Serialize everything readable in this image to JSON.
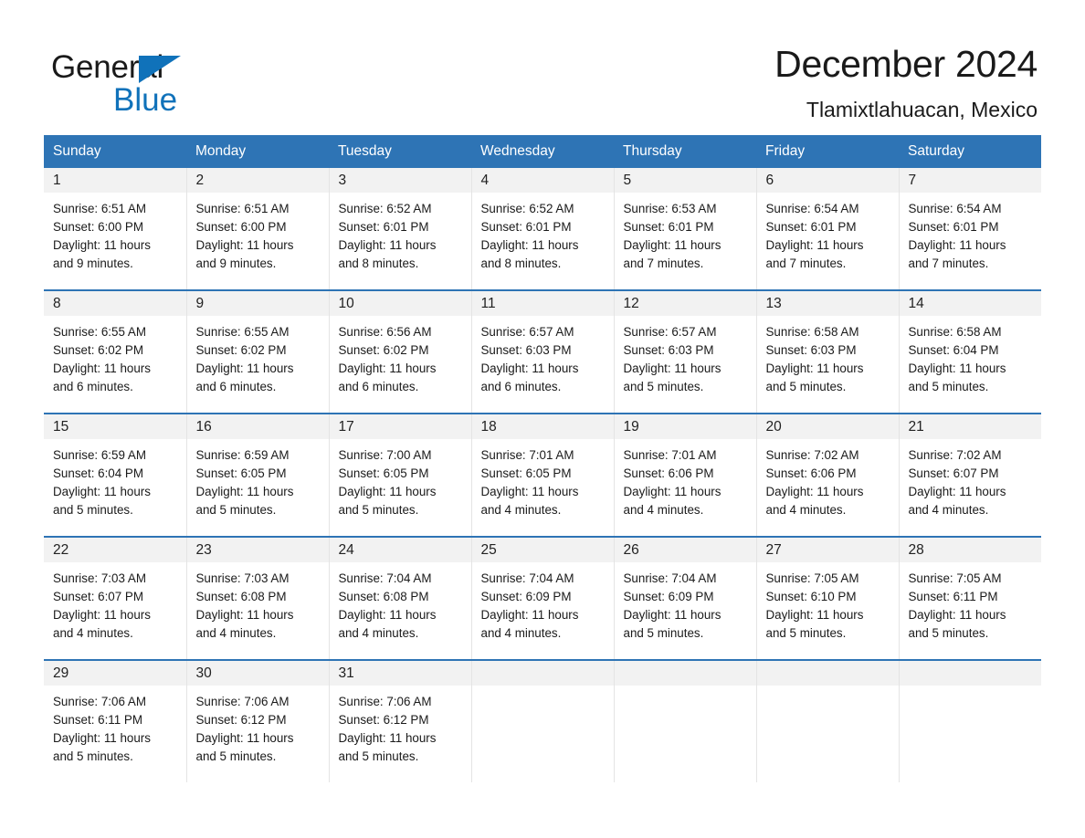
{
  "brand": {
    "name_part1": "General",
    "name_part2": "Blue",
    "accent_color": "#1072BA"
  },
  "header": {
    "title": "December 2024",
    "subtitle": "Tlamixtlahuacan, Mexico",
    "header_bar_color": "#2E74B5",
    "daynum_bg_color": "#F2F2F2"
  },
  "weekday_headers": [
    "Sunday",
    "Monday",
    "Tuesday",
    "Wednesday",
    "Thursday",
    "Friday",
    "Saturday"
  ],
  "weeks": [
    [
      {
        "day": "1",
        "sunrise": "Sunrise: 6:51 AM",
        "sunset": "Sunset: 6:00 PM",
        "daylight_line1": "Daylight: 11 hours",
        "daylight_line2": "and 9 minutes."
      },
      {
        "day": "2",
        "sunrise": "Sunrise: 6:51 AM",
        "sunset": "Sunset: 6:00 PM",
        "daylight_line1": "Daylight: 11 hours",
        "daylight_line2": "and 9 minutes."
      },
      {
        "day": "3",
        "sunrise": "Sunrise: 6:52 AM",
        "sunset": "Sunset: 6:01 PM",
        "daylight_line1": "Daylight: 11 hours",
        "daylight_line2": "and 8 minutes."
      },
      {
        "day": "4",
        "sunrise": "Sunrise: 6:52 AM",
        "sunset": "Sunset: 6:01 PM",
        "daylight_line1": "Daylight: 11 hours",
        "daylight_line2": "and 8 minutes."
      },
      {
        "day": "5",
        "sunrise": "Sunrise: 6:53 AM",
        "sunset": "Sunset: 6:01 PM",
        "daylight_line1": "Daylight: 11 hours",
        "daylight_line2": "and 7 minutes."
      },
      {
        "day": "6",
        "sunrise": "Sunrise: 6:54 AM",
        "sunset": "Sunset: 6:01 PM",
        "daylight_line1": "Daylight: 11 hours",
        "daylight_line2": "and 7 minutes."
      },
      {
        "day": "7",
        "sunrise": "Sunrise: 6:54 AM",
        "sunset": "Sunset: 6:01 PM",
        "daylight_line1": "Daylight: 11 hours",
        "daylight_line2": "and 7 minutes."
      }
    ],
    [
      {
        "day": "8",
        "sunrise": "Sunrise: 6:55 AM",
        "sunset": "Sunset: 6:02 PM",
        "daylight_line1": "Daylight: 11 hours",
        "daylight_line2": "and 6 minutes."
      },
      {
        "day": "9",
        "sunrise": "Sunrise: 6:55 AM",
        "sunset": "Sunset: 6:02 PM",
        "daylight_line1": "Daylight: 11 hours",
        "daylight_line2": "and 6 minutes."
      },
      {
        "day": "10",
        "sunrise": "Sunrise: 6:56 AM",
        "sunset": "Sunset: 6:02 PM",
        "daylight_line1": "Daylight: 11 hours",
        "daylight_line2": "and 6 minutes."
      },
      {
        "day": "11",
        "sunrise": "Sunrise: 6:57 AM",
        "sunset": "Sunset: 6:03 PM",
        "daylight_line1": "Daylight: 11 hours",
        "daylight_line2": "and 6 minutes."
      },
      {
        "day": "12",
        "sunrise": "Sunrise: 6:57 AM",
        "sunset": "Sunset: 6:03 PM",
        "daylight_line1": "Daylight: 11 hours",
        "daylight_line2": "and 5 minutes."
      },
      {
        "day": "13",
        "sunrise": "Sunrise: 6:58 AM",
        "sunset": "Sunset: 6:03 PM",
        "daylight_line1": "Daylight: 11 hours",
        "daylight_line2": "and 5 minutes."
      },
      {
        "day": "14",
        "sunrise": "Sunrise: 6:58 AM",
        "sunset": "Sunset: 6:04 PM",
        "daylight_line1": "Daylight: 11 hours",
        "daylight_line2": "and 5 minutes."
      }
    ],
    [
      {
        "day": "15",
        "sunrise": "Sunrise: 6:59 AM",
        "sunset": "Sunset: 6:04 PM",
        "daylight_line1": "Daylight: 11 hours",
        "daylight_line2": "and 5 minutes."
      },
      {
        "day": "16",
        "sunrise": "Sunrise: 6:59 AM",
        "sunset": "Sunset: 6:05 PM",
        "daylight_line1": "Daylight: 11 hours",
        "daylight_line2": "and 5 minutes."
      },
      {
        "day": "17",
        "sunrise": "Sunrise: 7:00 AM",
        "sunset": "Sunset: 6:05 PM",
        "daylight_line1": "Daylight: 11 hours",
        "daylight_line2": "and 5 minutes."
      },
      {
        "day": "18",
        "sunrise": "Sunrise: 7:01 AM",
        "sunset": "Sunset: 6:05 PM",
        "daylight_line1": "Daylight: 11 hours",
        "daylight_line2": "and 4 minutes."
      },
      {
        "day": "19",
        "sunrise": "Sunrise: 7:01 AM",
        "sunset": "Sunset: 6:06 PM",
        "daylight_line1": "Daylight: 11 hours",
        "daylight_line2": "and 4 minutes."
      },
      {
        "day": "20",
        "sunrise": "Sunrise: 7:02 AM",
        "sunset": "Sunset: 6:06 PM",
        "daylight_line1": "Daylight: 11 hours",
        "daylight_line2": "and 4 minutes."
      },
      {
        "day": "21",
        "sunrise": "Sunrise: 7:02 AM",
        "sunset": "Sunset: 6:07 PM",
        "daylight_line1": "Daylight: 11 hours",
        "daylight_line2": "and 4 minutes."
      }
    ],
    [
      {
        "day": "22",
        "sunrise": "Sunrise: 7:03 AM",
        "sunset": "Sunset: 6:07 PM",
        "daylight_line1": "Daylight: 11 hours",
        "daylight_line2": "and 4 minutes."
      },
      {
        "day": "23",
        "sunrise": "Sunrise: 7:03 AM",
        "sunset": "Sunset: 6:08 PM",
        "daylight_line1": "Daylight: 11 hours",
        "daylight_line2": "and 4 minutes."
      },
      {
        "day": "24",
        "sunrise": "Sunrise: 7:04 AM",
        "sunset": "Sunset: 6:08 PM",
        "daylight_line1": "Daylight: 11 hours",
        "daylight_line2": "and 4 minutes."
      },
      {
        "day": "25",
        "sunrise": "Sunrise: 7:04 AM",
        "sunset": "Sunset: 6:09 PM",
        "daylight_line1": "Daylight: 11 hours",
        "daylight_line2": "and 4 minutes."
      },
      {
        "day": "26",
        "sunrise": "Sunrise: 7:04 AM",
        "sunset": "Sunset: 6:09 PM",
        "daylight_line1": "Daylight: 11 hours",
        "daylight_line2": "and 5 minutes."
      },
      {
        "day": "27",
        "sunrise": "Sunrise: 7:05 AM",
        "sunset": "Sunset: 6:10 PM",
        "daylight_line1": "Daylight: 11 hours",
        "daylight_line2": "and 5 minutes."
      },
      {
        "day": "28",
        "sunrise": "Sunrise: 7:05 AM",
        "sunset": "Sunset: 6:11 PM",
        "daylight_line1": "Daylight: 11 hours",
        "daylight_line2": "and 5 minutes."
      }
    ],
    [
      {
        "day": "29",
        "sunrise": "Sunrise: 7:06 AM",
        "sunset": "Sunset: 6:11 PM",
        "daylight_line1": "Daylight: 11 hours",
        "daylight_line2": "and 5 minutes."
      },
      {
        "day": "30",
        "sunrise": "Sunrise: 7:06 AM",
        "sunset": "Sunset: 6:12 PM",
        "daylight_line1": "Daylight: 11 hours",
        "daylight_line2": "and 5 minutes."
      },
      {
        "day": "31",
        "sunrise": "Sunrise: 7:06 AM",
        "sunset": "Sunset: 6:12 PM",
        "daylight_line1": "Daylight: 11 hours",
        "daylight_line2": "and 5 minutes."
      },
      {
        "day": "",
        "sunrise": "",
        "sunset": "",
        "daylight_line1": "",
        "daylight_line2": ""
      },
      {
        "day": "",
        "sunrise": "",
        "sunset": "",
        "daylight_line1": "",
        "daylight_line2": ""
      },
      {
        "day": "",
        "sunrise": "",
        "sunset": "",
        "daylight_line1": "",
        "daylight_line2": ""
      },
      {
        "day": "",
        "sunrise": "",
        "sunset": "",
        "daylight_line1": "",
        "daylight_line2": ""
      }
    ]
  ]
}
